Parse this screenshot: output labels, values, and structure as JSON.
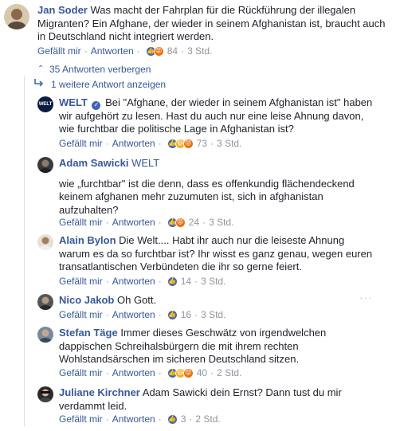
{
  "top_comment": {
    "author": "Jan Soder",
    "text": "Was macht der Fahrplan für die Rückführung der illegalen Migranten? Ein Afghane, der wieder in seinem Afghanistan ist, braucht auch in Deutschland nicht integriert werden.",
    "like_label": "Gefällt mir",
    "reply_label": "Antworten",
    "reaction_count": "84",
    "time": "3 Std."
  },
  "hide_replies_label": "35 Antworten verbergen",
  "more_replies_label": "1 weitere Antwort anzeigen",
  "replies": [
    {
      "author": "WELT",
      "verified": true,
      "line1": "Bei \"Afghane, der wieder in seinem Afghanistan ist\" haben",
      "line2": "wir aufgehört zu lesen. Hast du auch nur eine leise Ahnung davon,",
      "line3": "wie furchtbar die politische Lage in Afghanistan ist?",
      "like_label": "Gefällt mir",
      "reply_label": "Antworten",
      "reaction_count": "73",
      "time": "3 Std."
    },
    {
      "author": "Adam Sawicki",
      "mention": "WELT",
      "line1": "wie „furchtbar\" ist die denn, dass es offenkundig flächendeckend",
      "line2": "keinem afghanen mehr zuzumuten ist, sich in afghanistan",
      "line3": "aufzuhalten?",
      "like_label": "Gefällt mir",
      "reply_label": "Antworten",
      "reaction_count": "24",
      "time": "3 Std."
    },
    {
      "author": "Alain Bylon",
      "line1": "Die Welt.... Habt ihr auch nur die leiseste Ahnung",
      "line2": "warum es da so furchtbar ist? Ihr wisst es ganz genau, wegen euren",
      "line3": "transatlantischen Verbündeten die ihr so gerne feiert.",
      "like_label": "Gefällt mir",
      "reply_label": "Antworten",
      "reaction_count": "14",
      "time": "3 Std."
    },
    {
      "author": "Nico Jakob",
      "line1": "Oh Gott.",
      "like_label": "Gefällt mir",
      "reply_label": "Antworten",
      "reaction_count": "16",
      "time": "3 Std."
    },
    {
      "author": "Stefan Täge",
      "line1": "Immer dieses Geschwätz von irgendwelchen",
      "line2": "dappischen Schreihalsbürgern die mit ihrem rechten",
      "line3": "Wohlstandsärschen im sicheren Deutschland sitzen.",
      "like_label": "Gefällt mir",
      "reply_label": "Antworten",
      "reaction_count": "40",
      "time": "2 Std."
    },
    {
      "author": "Juliane Kirchner",
      "line1": "Adam Sawicki dein Ernst? Dann tust du mir",
      "line2": "verdammt leid.",
      "like_label": "Gefällt mir",
      "reply_label": "Antworten",
      "reaction_count": "3",
      "time": "2 Std."
    }
  ],
  "welt_logo_text": "WELT",
  "more_options_label": "···",
  "colors": {
    "link_blue": "#365899",
    "meta_gray": "#90949c",
    "like_blue": "#4267b2",
    "haha_yellow": "#f7b125",
    "angry_orange": "#e9710f"
  }
}
